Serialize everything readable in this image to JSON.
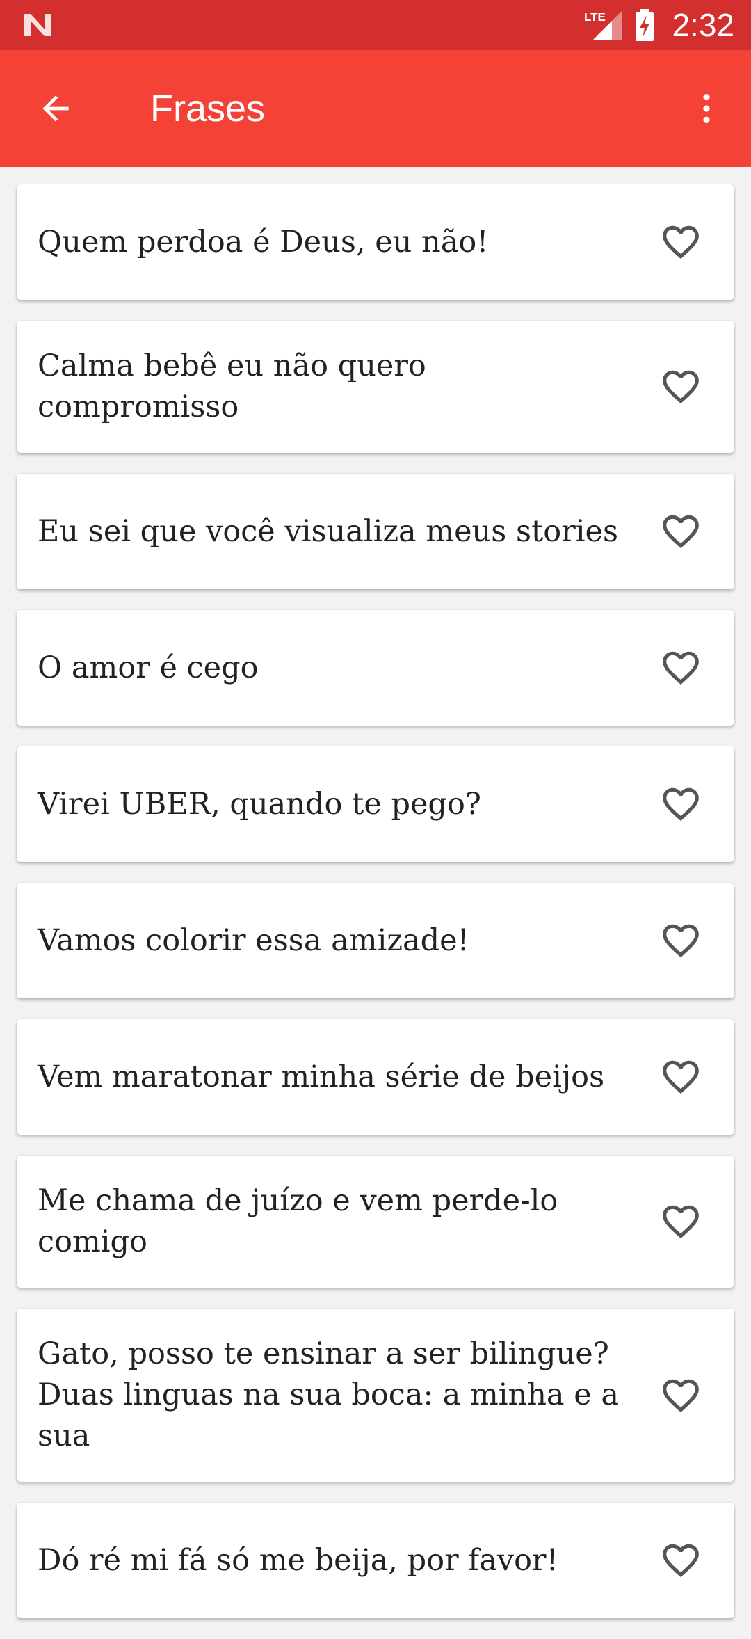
{
  "status_bar": {
    "network": "LTE",
    "time": "2:32"
  },
  "app_bar": {
    "title": "Frases",
    "back_icon": "arrow-back-icon",
    "menu_icon": "more-vert-icon"
  },
  "colors": {
    "status_bar": "#d32f2f",
    "app_bar": "#f44336",
    "background": "#f2f2f2",
    "heart_outline": "#555555"
  },
  "phrases": [
    {
      "text": "Quem perdoa é Deus, eu não!",
      "favorite": false
    },
    {
      "text": "Calma bebê eu não quero compromisso",
      "favorite": false
    },
    {
      "text": "Eu sei que você visualiza meus stories",
      "favorite": false
    },
    {
      "text": "O amor é cego",
      "favorite": false
    },
    {
      "text": "Virei UBER, quando te pego?",
      "favorite": false
    },
    {
      "text": "Vamos colorir essa amizade!",
      "favorite": false
    },
    {
      "text": "Vem maratonar minha série de beijos",
      "favorite": false
    },
    {
      "text": "Me chama de juízo e vem perde-lo comigo",
      "favorite": false
    },
    {
      "text": "Gato, posso te ensinar a ser bilingue? Duas linguas na sua boca: a minha e a sua",
      "favorite": false
    },
    {
      "text": "Dó ré mi fá só me beija, por favor!",
      "favorite": false
    }
  ]
}
